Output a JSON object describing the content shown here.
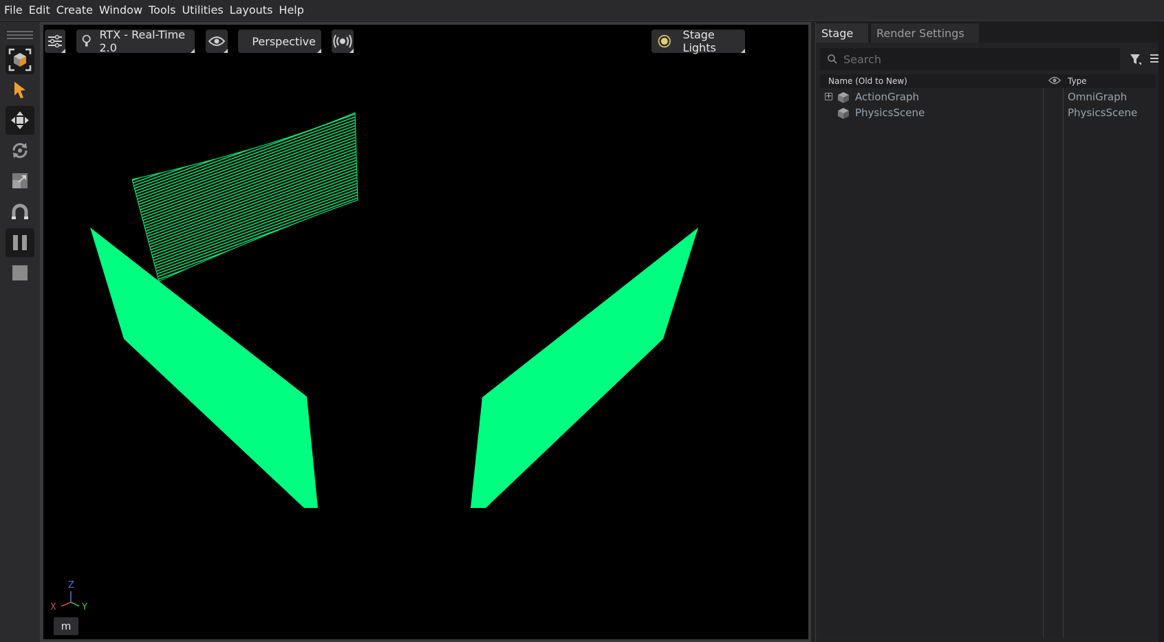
{
  "menubar": {
    "items": [
      "File",
      "Edit",
      "Create",
      "Window",
      "Tools",
      "Utilities",
      "Layouts",
      "Help"
    ]
  },
  "left_toolbar": {
    "tools": [
      {
        "name": "frame-tool",
        "icon": "frame-cube-icon",
        "active": true
      },
      {
        "name": "select-tool",
        "icon": "select-arrow-icon",
        "active": false
      },
      {
        "name": "move-tool",
        "icon": "move-icon",
        "active": true
      },
      {
        "name": "rotate-tool",
        "icon": "rotate-icon",
        "active": false
      },
      {
        "name": "scale-tool",
        "icon": "scale-icon",
        "active": false
      },
      {
        "name": "snap-tool",
        "icon": "magnet-icon",
        "active": false
      },
      {
        "name": "pause-button",
        "icon": "pause-icon",
        "active": true
      },
      {
        "name": "stop-button",
        "icon": "stop-icon",
        "active": false
      }
    ]
  },
  "viewport": {
    "renderer_label": "RTX - Real-Time 2.0",
    "camera_label": "Perspective",
    "lights_label": "Stage Lights",
    "units_label": "m",
    "axis": {
      "x": "X",
      "y": "Y",
      "z": "Z"
    },
    "mesh_color": "#00ff80",
    "background": "#000000"
  },
  "stage_panel": {
    "tabs": [
      {
        "label": "Stage",
        "active": true
      },
      {
        "label": "Render Settings",
        "active": false
      }
    ],
    "search_placeholder": "Search",
    "columns": {
      "name": "Name (Old to New)",
      "type": "Type"
    },
    "rows": [
      {
        "name": "ActionGraph",
        "type": "OmniGraph",
        "expandable": true
      },
      {
        "name": "PhysicsScene",
        "type": "PhysicsScene",
        "expandable": false
      }
    ]
  }
}
